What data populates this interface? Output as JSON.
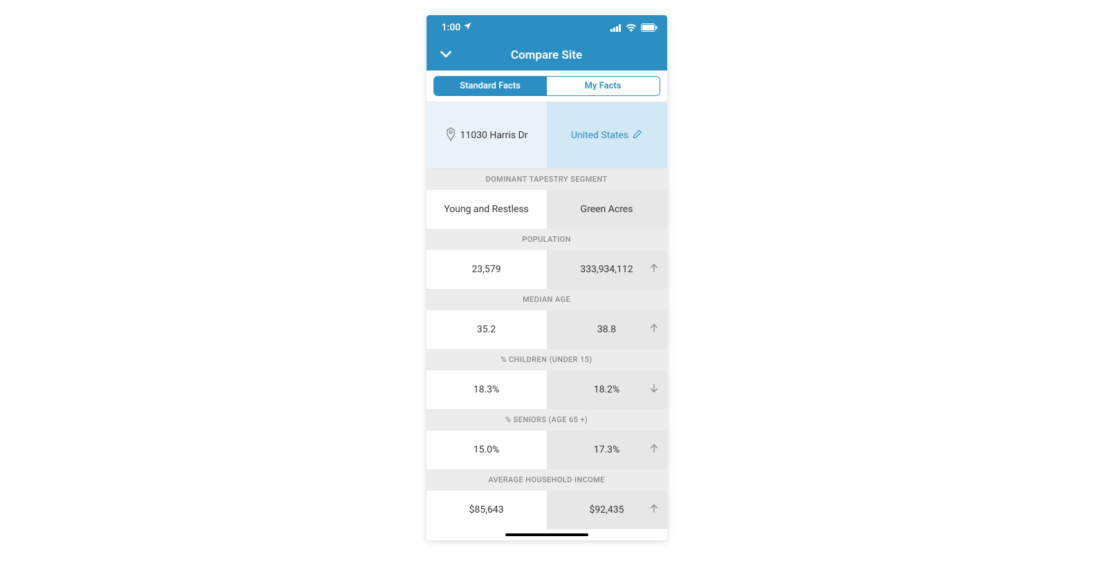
{
  "status": {
    "time": "1:00",
    "location_arrow": true
  },
  "nav": {
    "title": "Compare Site"
  },
  "tabs": {
    "standard": "Standard Facts",
    "my": "My Facts"
  },
  "locations": {
    "site": "11030 Harris Dr",
    "compare": "United States"
  },
  "sections": [
    {
      "header": "DOMINANT TAPESTRY SEGMENT",
      "left": "Young and Restless",
      "right": "Green Acres",
      "trend": "none"
    },
    {
      "header": "POPULATION",
      "left": "23,579",
      "right": "333,934,112",
      "trend": "up"
    },
    {
      "header": "MEDIAN AGE",
      "left": "35.2",
      "right": "38.8",
      "trend": "up"
    },
    {
      "header": "% CHILDREN (UNDER 15)",
      "left": "18.3%",
      "right": "18.2%",
      "trend": "down"
    },
    {
      "header": "% SENIORS (AGE 65 +)",
      "left": "15.0%",
      "right": "17.3%",
      "trend": "up"
    },
    {
      "header": "AVERAGE HOUSEHOLD INCOME",
      "left": "$85,643",
      "right": "$92,435",
      "trend": "up"
    }
  ]
}
